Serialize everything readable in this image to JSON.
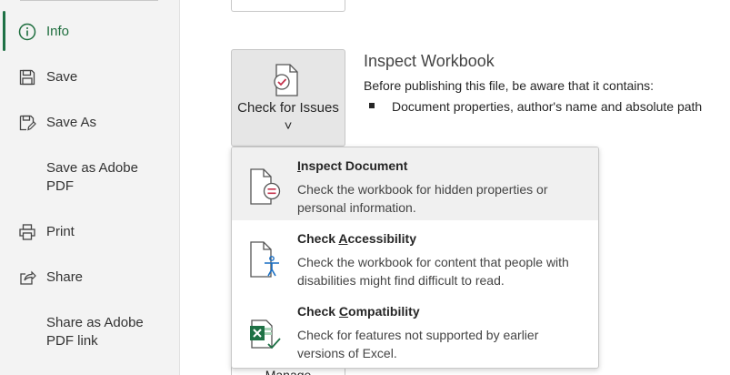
{
  "sidebar": {
    "items": [
      {
        "label": "Info",
        "icon": "info-icon"
      },
      {
        "label": "Save",
        "icon": "save-icon"
      },
      {
        "label": "Save As",
        "icon": "save-as-icon"
      },
      {
        "label": "Save as Adobe PDF",
        "icon": ""
      },
      {
        "label": "Print",
        "icon": "print-icon"
      },
      {
        "label": "Share",
        "icon": "share-icon"
      },
      {
        "label": "Share as Adobe PDF link",
        "icon": ""
      }
    ],
    "active": "Info",
    "accent_color": "#1e7145"
  },
  "check_button": {
    "label": "Check for Issues ˅",
    "icon": "document-check-icon"
  },
  "inspect": {
    "title": "Inspect Workbook",
    "description": "Before publishing this file, be aware that it contains:",
    "bullets": [
      "Document properties, author's name and absolute path"
    ]
  },
  "manage_button": {
    "label": "Manage"
  },
  "menu": {
    "items": [
      {
        "access_key": "I",
        "title_rest": "nspect Document",
        "title_prefix": "",
        "description": "Check the workbook for hidden properties or personal information.",
        "icon": "inspect-document-icon"
      },
      {
        "title_prefix": "Check ",
        "access_key": "A",
        "title_rest": "ccessibility",
        "description": "Check the workbook for content that people with disabilities might find difficult to read.",
        "icon": "accessibility-icon"
      },
      {
        "title_prefix": "Check ",
        "access_key": "C",
        "title_rest": "ompatibility",
        "description": "Check for features not supported by earlier versions of Excel.",
        "icon": "excel-compatibility-icon"
      }
    ]
  }
}
